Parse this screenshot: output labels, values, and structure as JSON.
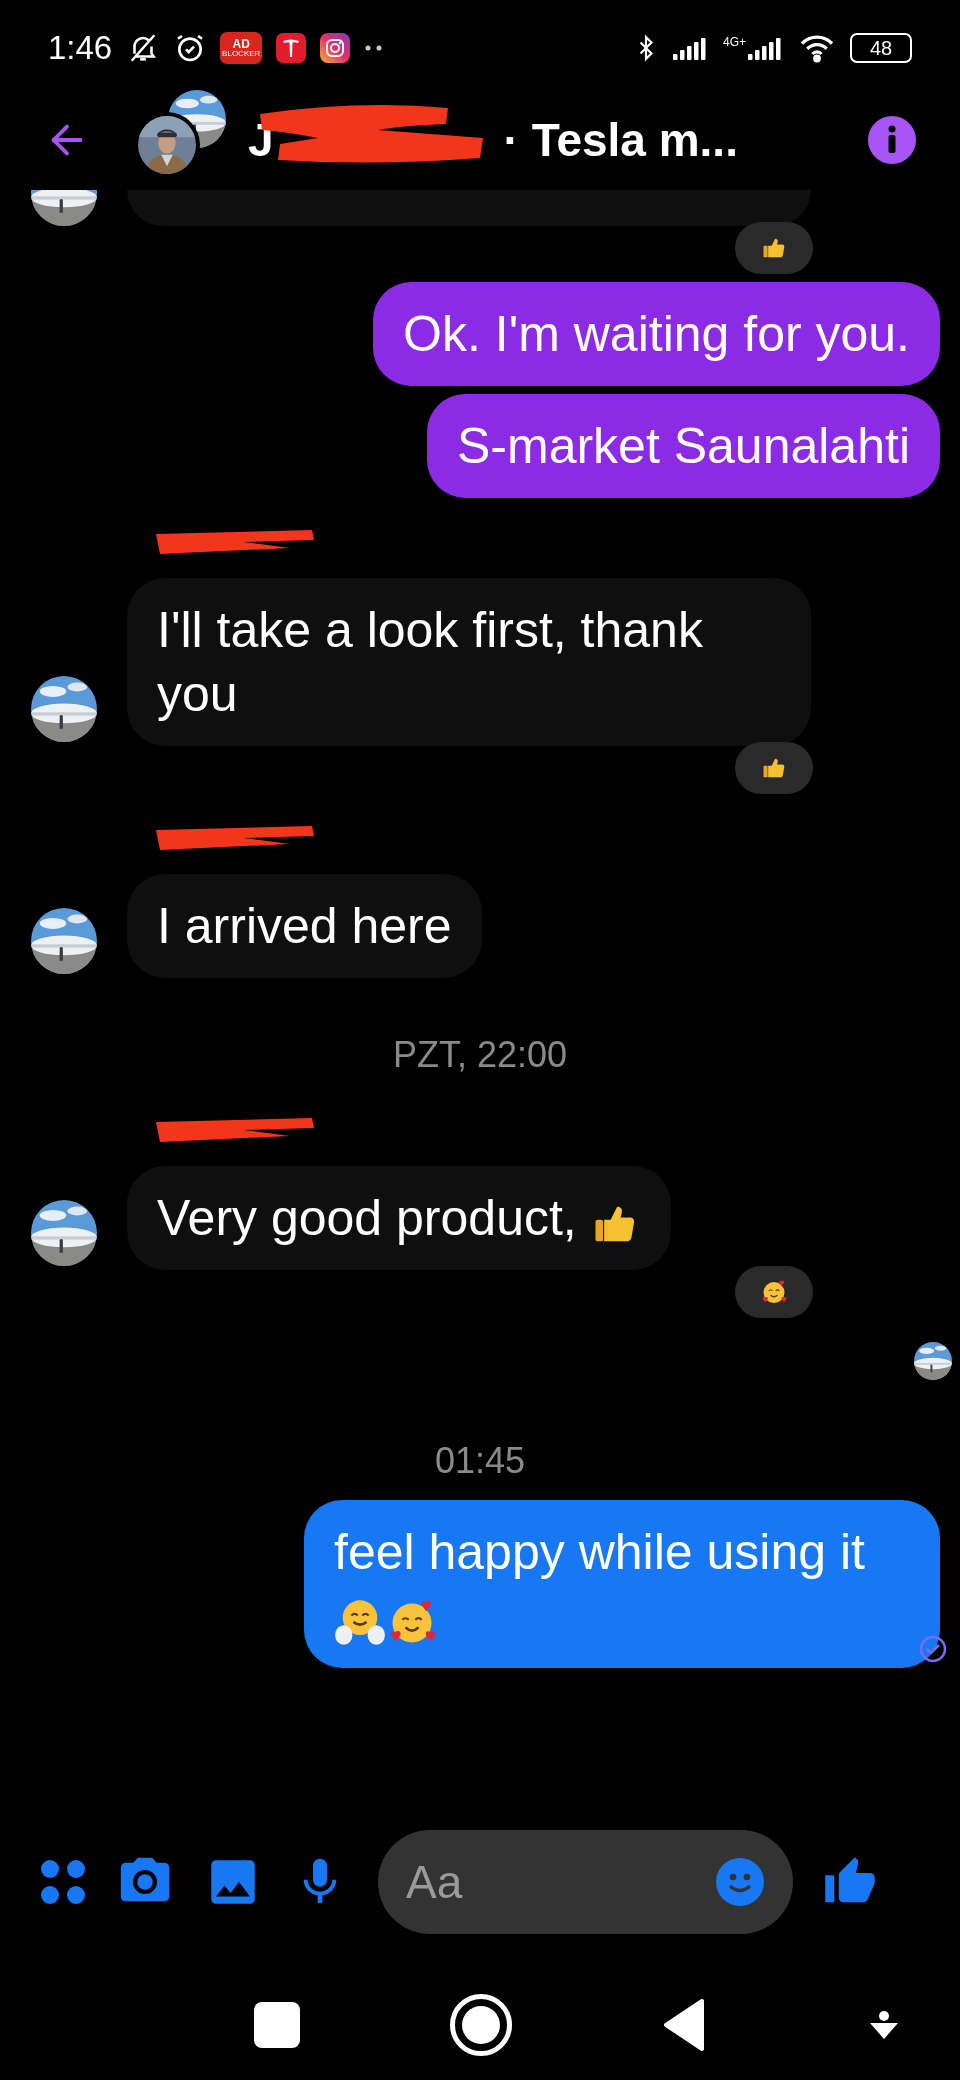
{
  "status_bar": {
    "time": "1:46",
    "app_icons": [
      {
        "kind": "adblock",
        "label": "AD",
        "sublabel": "BLOCKER"
      },
      {
        "kind": "tesla"
      },
      {
        "kind": "instagram"
      }
    ],
    "network_label": "4G+",
    "battery": "48"
  },
  "header": {
    "title_start": "J",
    "title_end": "· Tesla m..."
  },
  "messages": [
    {
      "kind": "incoming_cut",
      "avatar": true
    },
    {
      "kind": "reaction",
      "reaction": {
        "kind": "like"
      }
    },
    {
      "kind": "outgoing",
      "text": "Ok. I'm waiting for you.",
      "color": "#8b2be6"
    },
    {
      "kind": "outgoing",
      "text": "S-market Saunalahti",
      "color": "#8b2be6"
    },
    {
      "kind": "redacted_name"
    },
    {
      "kind": "incoming",
      "text": "I'll take a look first, thank you",
      "avatar": true
    },
    {
      "kind": "reaction",
      "reaction": {
        "kind": "like"
      }
    },
    {
      "kind": "redacted_name"
    },
    {
      "kind": "incoming",
      "text": "I arrived here",
      "avatar": true
    },
    {
      "kind": "time",
      "text": "PZT, 22:00"
    },
    {
      "kind": "redacted_name"
    },
    {
      "kind": "incoming",
      "text": "Very good product,",
      "emojis": [
        {
          "kind": "like"
        }
      ],
      "avatar": true
    },
    {
      "kind": "reaction",
      "reaction": {
        "kind": "love"
      }
    },
    {
      "kind": "seen"
    },
    {
      "kind": "time",
      "text": "01:45"
    },
    {
      "kind": "outgoing",
      "text": "feel happy while using it",
      "emojis": [
        {
          "kind": "hug"
        },
        {
          "kind": "love"
        }
      ],
      "color": "#1877f2",
      "delivered": true
    }
  ],
  "composer": {
    "placeholder": "Aa"
  }
}
